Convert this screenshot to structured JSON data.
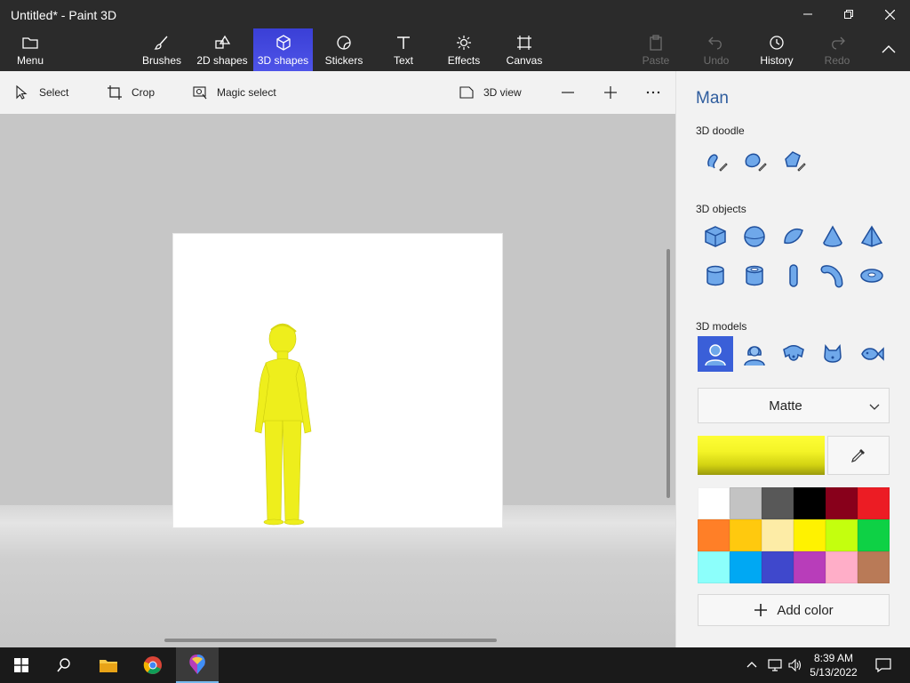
{
  "window": {
    "title": "Untitled* - Paint 3D"
  },
  "ribbon": {
    "menu_label": "Menu",
    "brushes_label": "Brushes",
    "shapes2d_label": "2D shapes",
    "shapes3d_label": "3D shapes",
    "stickers_label": "Stickers",
    "text_label": "Text",
    "effects_label": "Effects",
    "canvas_label": "Canvas",
    "paste_label": "Paste",
    "undo_label": "Undo",
    "history_label": "History",
    "redo_label": "Redo"
  },
  "toolbar": {
    "select_label": "Select",
    "crop_label": "Crop",
    "magic_select_label": "Magic select",
    "view3d_label": "3D view"
  },
  "panel": {
    "title": "Man",
    "doodle_heading": "3D doodle",
    "objects_heading": "3D objects",
    "models_heading": "3D models",
    "material": "Matte",
    "current_color": "#f2f222",
    "add_color_label": "Add color",
    "palette": [
      "#ffffff",
      "#c3c3c3",
      "#585858",
      "#000000",
      "#88001b",
      "#ec1c24",
      "#ff7f27",
      "#ffc90e",
      "#fdeca6",
      "#fff200",
      "#c4ff0e",
      "#0ed145",
      "#8cfffb",
      "#00a8f3",
      "#3f48cc",
      "#b83dba",
      "#ffaec8",
      "#b97a57"
    ]
  },
  "icons": {
    "doodle": [
      "sharp-edge-doodle-icon",
      "soft-edge-doodle-icon",
      "tube-doodle-icon"
    ],
    "objects": [
      "cube-icon",
      "sphere-icon",
      "hemisphere-icon",
      "cone-icon",
      "pyramid-icon",
      "cylinder-icon",
      "tube-icon",
      "capsule-icon",
      "bent-tube-icon",
      "donut-icon"
    ],
    "models": [
      "man-model-icon",
      "woman-model-icon",
      "dog-model-icon",
      "cat-model-icon",
      "fish-model-icon"
    ]
  },
  "taskbar": {
    "time": "8:39 AM",
    "date": "5/13/2022"
  }
}
